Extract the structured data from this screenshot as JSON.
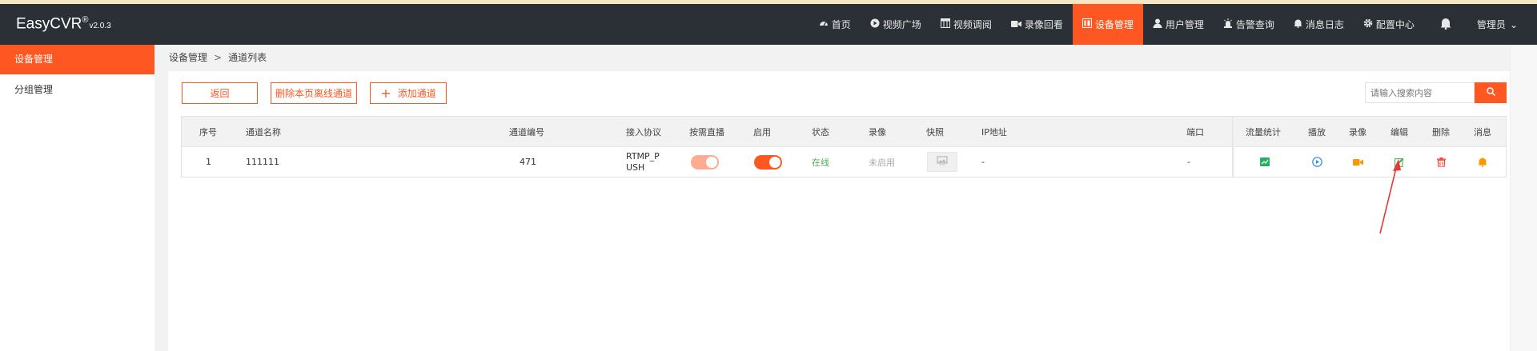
{
  "app": {
    "logo_text": "EasyCVR",
    "logo_mark": "®",
    "version": "v2.0.3"
  },
  "nav": {
    "items": [
      {
        "label": "首页",
        "icon": "dashboard-icon"
      },
      {
        "label": "视频广场",
        "icon": "play-circle-icon"
      },
      {
        "label": "视频调阅",
        "icon": "grid-layout-icon"
      },
      {
        "label": "录像回看",
        "icon": "video-camera-icon"
      },
      {
        "label": "设备管理",
        "icon": "device-icon",
        "active": true
      },
      {
        "label": "用户管理",
        "icon": "user-icon"
      },
      {
        "label": "告警查询",
        "icon": "alarm-icon"
      },
      {
        "label": "消息日志",
        "icon": "bell-small-icon"
      },
      {
        "label": "配置中心",
        "icon": "gear-icon"
      }
    ],
    "bell_icon": "bell-icon",
    "user_label": "管理员",
    "user_caret": "⌄"
  },
  "sidebar": {
    "items": [
      {
        "label": "设备管理",
        "active": true
      },
      {
        "label": "分组管理"
      }
    ]
  },
  "breadcrumb": {
    "root": "设备管理",
    "separator": ">",
    "current": "通道列表"
  },
  "toolbar": {
    "back_label": "返回",
    "delete_offline_label": "删除本页离线通道",
    "add_plus": "+",
    "add_label": "添加通道"
  },
  "search": {
    "placeholder": "请输入搜索内容",
    "icon": "search-icon"
  },
  "table": {
    "columns": {
      "index": "序号",
      "name": "通道名称",
      "number": "通道编号",
      "protocol": "接入协议",
      "on_demand": "按需直播",
      "enabled": "启用",
      "status": "状态",
      "record": "录像",
      "snapshot": "快照",
      "ip": "IP地址",
      "port": "端口",
      "traffic": "流量统计",
      "play": "播放",
      "record_action": "录像",
      "edit": "编辑",
      "delete": "删除",
      "message": "消息"
    },
    "rows": [
      {
        "index": "1",
        "name": "111111",
        "number": "471",
        "protocol_line1": "RTMP_P",
        "protocol_line2": "USH",
        "on_demand": true,
        "enabled": true,
        "status": "在线",
        "record": "未启用",
        "snapshot_icon": "image-placeholder-icon",
        "ip": "-",
        "port": "-"
      }
    ]
  },
  "colors": {
    "accent": "#ff5722",
    "header_bg": "#2b3036",
    "status_online": "#4caf50",
    "traffic_icon": "#27ae60",
    "play_icon": "#2d8cf0",
    "record_icon": "#ff9800",
    "edit_icon": "#4caf50",
    "delete_icon": "#f44336",
    "message_icon": "#ff9800"
  }
}
